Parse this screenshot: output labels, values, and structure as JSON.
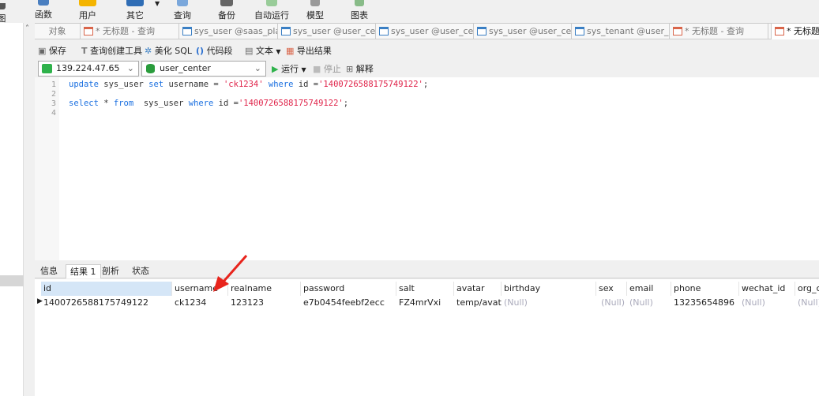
{
  "topbar": {
    "items": [
      "图",
      "函数",
      "用户",
      "其它",
      "查询",
      "备份",
      "自动运行",
      "模型",
      "图表"
    ]
  },
  "tabs": [
    {
      "label": "对象",
      "icon": "none"
    },
    {
      "label": "* 无标题 - 查询",
      "icon": "query-icon"
    },
    {
      "label": "sys_user @saas_plat...",
      "icon": "table-icon"
    },
    {
      "label": "sys_user @user_cent...",
      "icon": "table-icon"
    },
    {
      "label": "sys_user @user_cent...",
      "icon": "table-edit-icon"
    },
    {
      "label": "sys_user @user_cent...",
      "icon": "table-icon"
    },
    {
      "label": "sys_tenant @user_ce...",
      "icon": "table-icon"
    },
    {
      "label": "* 无标题 - 查询",
      "icon": "query-icon"
    },
    {
      "label": "* 无标题 -",
      "icon": "query-icon"
    }
  ],
  "toolbar": {
    "save": "保存",
    "query_builder": "查询创建工具",
    "beautify": "美化 SQL",
    "snippet": "代码段",
    "text": "文本",
    "export": "导出结果"
  },
  "conn": {
    "host": "139.224.47.65",
    "database": "user_center",
    "run": "运行",
    "stop": "停止",
    "explain": "解释"
  },
  "editor": {
    "line_numbers": [
      "1",
      "2",
      "3",
      "4"
    ]
  },
  "result_tabs": [
    "信息",
    "结果 1",
    "剖析",
    "状态"
  ],
  "grid": {
    "columns": [
      "id",
      "username",
      "realname",
      "password",
      "salt",
      "avatar",
      "birthday",
      "sex",
      "email",
      "phone",
      "wechat_id",
      "org_c"
    ],
    "rows": [
      [
        "1400726588175749122",
        "ck1234",
        "123123",
        "e7b0454feebf2ecc",
        "FZ4mrVxi",
        "temp/avatar",
        "(Null)",
        "(Null)",
        "(Null)",
        "13235654896",
        "(Null)",
        "(Null)"
      ]
    ]
  },
  "colors": {
    "keyword": "#1a6fe0",
    "string": "#e0244a",
    "annotation_arrow": "#e8241c"
  }
}
